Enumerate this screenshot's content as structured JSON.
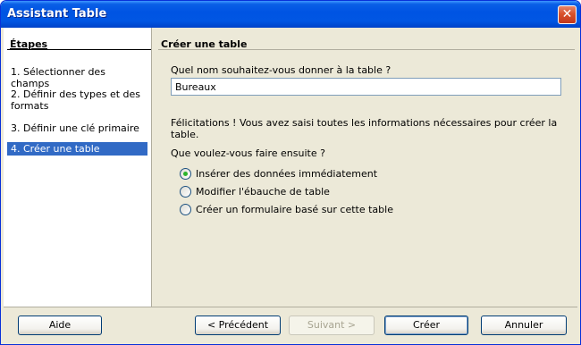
{
  "window": {
    "title": "Assistant Table",
    "close_glyph": "✕"
  },
  "sidebar": {
    "title": "Étapes",
    "steps": [
      {
        "label": "1. Sélectionner des champs",
        "active": false
      },
      {
        "label": "2. Définir des types et des formats",
        "active": false
      },
      {
        "label": "3. Définir une clé primaire",
        "active": false
      },
      {
        "label": "4. Créer une table",
        "active": true
      }
    ]
  },
  "content": {
    "title": "Créer une table",
    "name_prompt": "Quel nom souhaitez-vous donner à la table ?",
    "name_value": "Bureaux",
    "congrats": "Félicitations ! Vous avez saisi toutes les informations nécessaires pour créer la table.",
    "next_prompt": "Que voulez-vous faire ensuite ?",
    "options": [
      {
        "label": "Insérer des données immédiatement",
        "checked": true
      },
      {
        "label": "Modifier l'ébauche de table",
        "checked": false
      },
      {
        "label": "Créer un formulaire basé sur cette table",
        "checked": false
      }
    ]
  },
  "buttons": {
    "help": "Aide",
    "back": "< Précédent",
    "next": "Suivant >",
    "finish": "Créer",
    "cancel": "Annuler"
  }
}
